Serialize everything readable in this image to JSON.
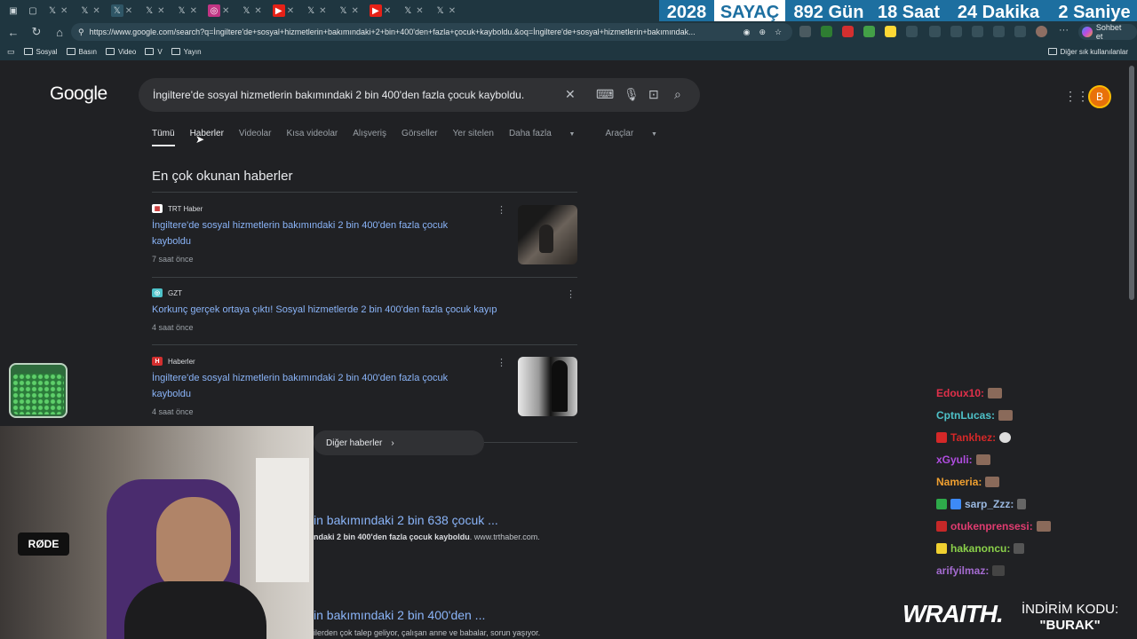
{
  "browser": {
    "url": "https://www.google.com/search?q=İngiltere'de+sosyal+hizmetlerin+bakımındaki+2+bin+400'den+fazla+çocuk+kayboldu.&oq=İngiltere'de+sosyal+hizmetlerin+bakımındak...",
    "chat_button": "Sohbet et",
    "bookmarks": [
      "Sosyal",
      "Basın",
      "Video",
      "V",
      "Yayın"
    ],
    "other_bookmarks": "Diğer sık kullanılanlar"
  },
  "counter_overlay": {
    "year": "2028",
    "label": "SAYAÇ",
    "days": "892 Gün",
    "hours": "18 Saat",
    "minutes": "24 Dakika",
    "seconds": "2 Saniye"
  },
  "google": {
    "logo": "Google",
    "query": "İngiltere'de sosyal hizmetlerin bakımındaki 2 bin 400'den fazla çocuk kayboldu.",
    "avatar_letter": "B",
    "tabs": [
      "Tümü",
      "Haberler",
      "Videolar",
      "Kısa videolar",
      "Alışveriş",
      "Görseller",
      "Yer sitelen",
      "Daha fazla",
      "Araçlar"
    ],
    "top_stories_title": "En çok okunan haberler",
    "news": [
      {
        "source": "TRT Haber",
        "title": "İngiltere'de sosyal hizmetlerin bakımındaki 2 bin 400'den fazla çocuk kayboldu",
        "time": "7 saat önce"
      },
      {
        "source": "GZT",
        "title": "Korkunç gerçek ortaya çıktı! Sosyal hizmetlerde 2 bin 400'den fazla çocuk kayıp",
        "time": "4 saat önce"
      },
      {
        "source": "Haberler",
        "title": "İngiltere'de sosyal hizmetlerin bakımındaki 2 bin 400'den fazla çocuk kayboldu",
        "time": "4 saat önce"
      }
    ],
    "more_news": "Diğer haberler",
    "results": [
      {
        "title": "in bakımındaki 2 bin 638 çocuk ...",
        "snippet_bold": "ndaki 2 bin 400'den fazla çocuk kayboldu",
        "snippet_rest": ". www.trthaber.com."
      },
      {
        "title": "in bakımındaki 2 bin 400'den ...",
        "snippet_bold": "",
        "snippet_rest": "ilerden çok talep geliyor, çalışan anne ve babalar, sorun yaşıyor."
      }
    ]
  },
  "webcam": {
    "mic_label": "RØDE"
  },
  "chat": [
    {
      "user": "Edoux10:",
      "color": "#e0304a"
    },
    {
      "user": "CptnLucas:",
      "color": "#4ec2c9"
    },
    {
      "user": "Tankhez:",
      "color": "#d42828"
    },
    {
      "user": "xGyuli:",
      "color": "#b04de0"
    },
    {
      "user": "Nameria:",
      "color": "#f0a030"
    },
    {
      "user": "sarp_Zzz:",
      "color": "#9ab8e0"
    },
    {
      "user": "otukenprensesi:",
      "color": "#e03c70"
    },
    {
      "user": "hakanoncu:",
      "color": "#8ad04a"
    },
    {
      "user": "arifyilmaz:",
      "color": "#a46bd0"
    }
  ],
  "sponsor": {
    "brand": "WRAITH.",
    "code_label": "İNDİRİM KODU:",
    "code": "\"BURAK\""
  },
  "colors": {
    "link": "#8ab4f8",
    "page_bg": "#202124",
    "browser_bg": "#1f3640"
  }
}
